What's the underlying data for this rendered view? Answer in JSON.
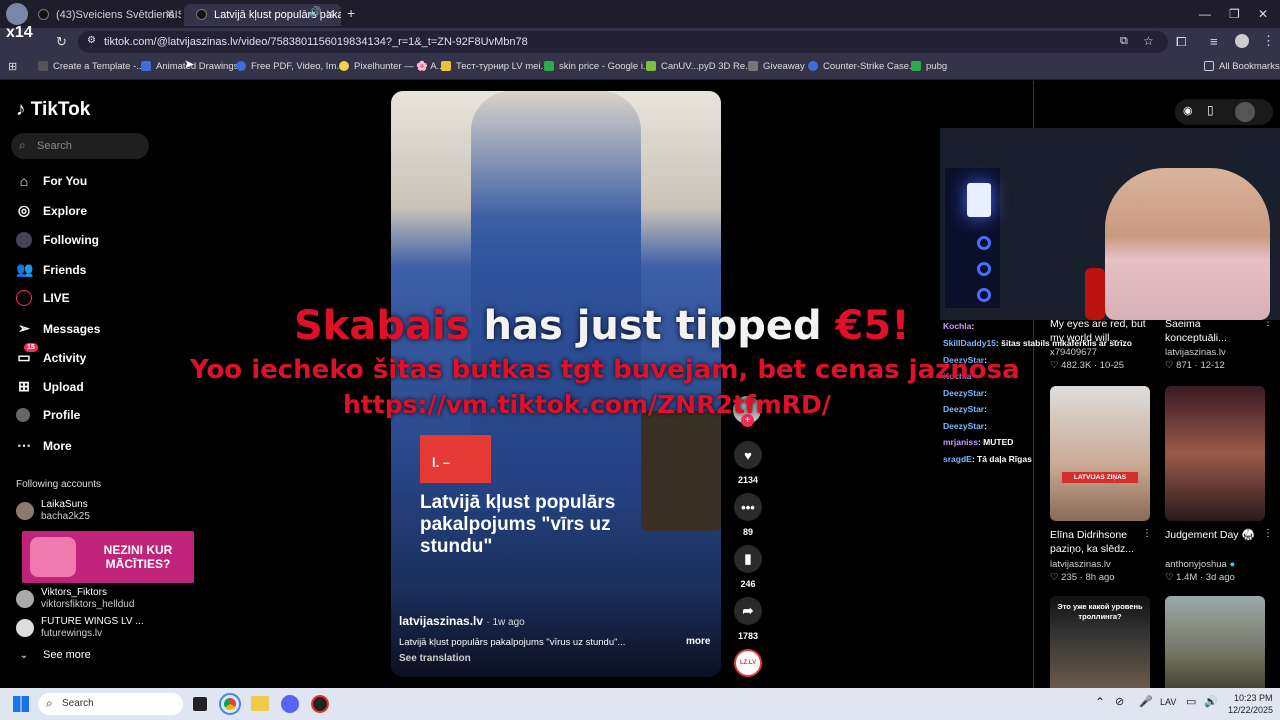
{
  "browser": {
    "tabs": [
      {
        "label": "(43)Sveiciens SvētdienāISveicie",
        "active": false
      },
      {
        "label": "Latvijā kļust populārs pakal",
        "active": true
      }
    ],
    "new_tab_icon": "plus-icon",
    "url": "tiktok.com/@latvijaszinas.lv/video/7583801156019834134?_r=1&_t=ZN-92F8UvMbn78",
    "bookmarks": [
      "Create a Template -...",
      "Animated Drawings",
      "Free PDF, Video, Im...",
      "Pixelhunter — 🌸 A...",
      "Тест-турнир LV mei...",
      "skin price - Google i...",
      "CanUV...pyD 3D Re...",
      "Giveaway",
      "Counter-Strike Case...",
      "pubg"
    ],
    "all_bookmarks": "All Bookmarks",
    "overlay_badge": "x14"
  },
  "sidebar": {
    "logo": "TikTok",
    "search_placeholder": "Search",
    "nav": [
      {
        "label": "For You",
        "icon": "home-icon"
      },
      {
        "label": "Explore",
        "icon": "compass-icon"
      },
      {
        "label": "Following",
        "icon": "following-icon"
      },
      {
        "label": "Friends",
        "icon": "friends-icon"
      },
      {
        "label": "LIVE",
        "icon": "live-icon"
      },
      {
        "label": "Messages",
        "icon": "messages-icon"
      },
      {
        "label": "Activity",
        "icon": "activity-icon",
        "badge": "15"
      },
      {
        "label": "Upload",
        "icon": "upload-icon"
      },
      {
        "label": "Profile",
        "icon": "profile-icon"
      },
      {
        "label": "More",
        "icon": "more-icon"
      }
    ],
    "following_header": "Following accounts",
    "accounts": [
      {
        "name": "LaikaSuns",
        "handle": "bacha2k25"
      },
      {
        "name": "Viktors_Fiktors",
        "handle": "viktorsfiktors_helldud"
      },
      {
        "name": "FUTURE WINGS LV ...",
        "handle": "futurewings.lv"
      }
    ],
    "ad_text": "NEZINI KUR MĀCĪTIES?",
    "see_more": "See more"
  },
  "video": {
    "logo_text": "l. –",
    "headline": "Latvijā kļust populārs pakalpojums \"vīrs uz stundu\"",
    "author": "latvijaszinas.lv",
    "age": "· 1w ago",
    "caption": "Latvijā kļust populārs pakalpojums \"vīrus uz stundu\"...",
    "more": "more",
    "see_translation": "See translation"
  },
  "actions": {
    "likes": "2134",
    "comments": "89",
    "saves": "246",
    "shares": "1783",
    "avatar_text": "LZ.LV"
  },
  "overlay": {
    "tipper": "Skabais",
    "tip_text": "has just tipped",
    "tip_amount": "€5!",
    "message": "Yoo iecheko šitas butkas tgt buvejam, bet cenas jaznosa",
    "link": "https://vm.tiktok.com/ZNR2tfmRD/"
  },
  "chat": [
    {
      "user": "Kochla",
      "text": ": "
    },
    {
      "user": "SkillDaddy15",
      "text": ": šitas stabils mikaferklis ar strīzo"
    },
    {
      "user": "",
      "text": "Kochla"
    },
    {
      "user": "DeezyStar",
      "text": ":"
    },
    {
      "user": "DeezyStar",
      "text": ":"
    },
    {
      "user": "DeezyStar",
      "text": ":"
    },
    {
      "user": "DeezyStar",
      "text": ":"
    },
    {
      "user": "mrjaniss",
      "text": ": MUTED"
    },
    {
      "user": "sragdE",
      "text": ": Tā daļa Rīgas"
    }
  ],
  "grid": [
    {
      "title": "My eyes are red, but my world will...",
      "author": "x79409677",
      "likes": "482.3K",
      "age": "10-25"
    },
    {
      "title": "Saeima konceptuāli...",
      "author": "latvijaszinas.lv",
      "likes": "871",
      "age": "12-12"
    },
    {
      "title": "Elīna Didrihsone paziņo, ka slēdz...",
      "author": "latvijaszinas.lv",
      "likes": "235",
      "age": "8h ago",
      "thumb_label": "LATVIJAS ZIŅAS"
    },
    {
      "title": "Judgement Day 🥋",
      "author": "anthonyjoshua",
      "likes": "1.4M",
      "age": "3d ago"
    },
    {
      "title": "",
      "thumb_label": "Это уже какой уровень троллинга?"
    }
  ],
  "taskbar": {
    "search": "Search",
    "lang": "LAV",
    "time": "10:23 PM",
    "date": "12/22/2025"
  },
  "colors": {
    "accent": "#fe2c55",
    "tip_red": "#e0102a"
  }
}
